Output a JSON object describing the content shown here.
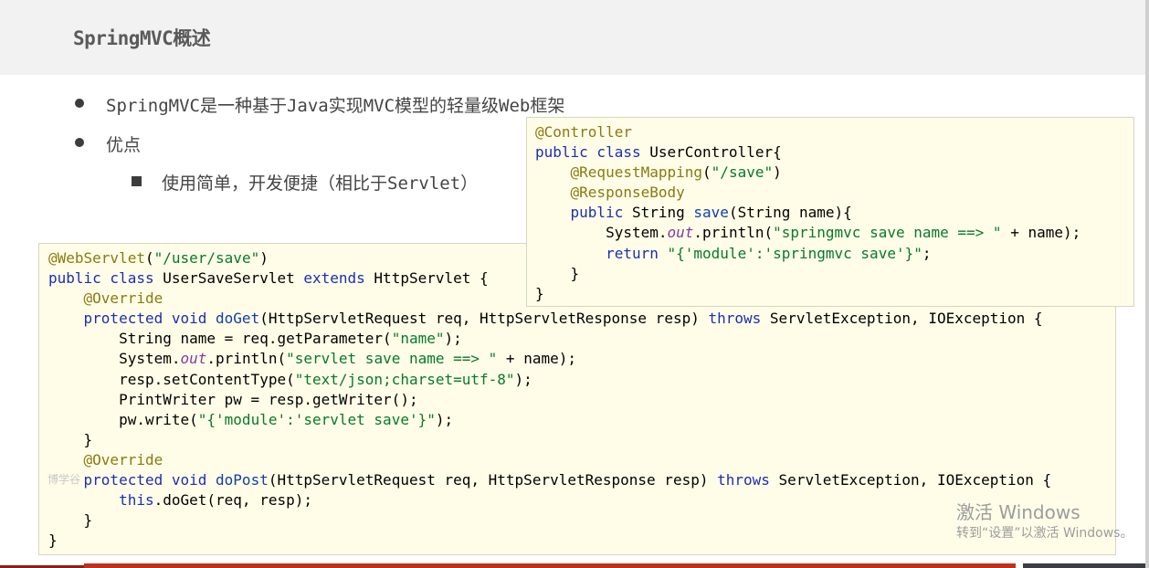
{
  "slide": {
    "title": "SpringMVC概述",
    "bullets": [
      {
        "text": "SpringMVC是一种基于Java实现MVC模型的轻量级Web框架"
      },
      {
        "text": "优点"
      }
    ],
    "sub_bullets": [
      {
        "text": "使用简单，开发便捷（相比于Servlet）"
      }
    ]
  },
  "code_servlet": {
    "lines": [
      [
        [
          "ann",
          "@WebServlet"
        ],
        [
          "p",
          "("
        ],
        [
          "str",
          "\"/user/save\""
        ],
        [
          "p",
          ")"
        ]
      ],
      [
        [
          "kw",
          "public class "
        ],
        [
          "p",
          "UserSaveServlet "
        ],
        [
          "kw",
          "extends "
        ],
        [
          "p",
          "HttpServlet {"
        ]
      ],
      [
        [
          "p",
          "    "
        ],
        [
          "ann",
          "@Override"
        ]
      ],
      [
        [
          "p",
          "    "
        ],
        [
          "kw",
          "protected void "
        ],
        [
          "mth",
          "doGet"
        ],
        [
          "p",
          "(HttpServletRequest req, HttpServletResponse resp) "
        ],
        [
          "kw",
          "throws "
        ],
        [
          "p",
          "ServletException, IOException {"
        ]
      ],
      [
        [
          "p",
          "        String name = req.getParameter("
        ],
        [
          "str",
          "\"name\""
        ],
        [
          "p",
          ");"
        ]
      ],
      [
        [
          "p",
          "        System."
        ],
        [
          "fld",
          "out"
        ],
        [
          "p",
          ".println("
        ],
        [
          "str",
          "\"servlet save name ==> \""
        ],
        [
          "p",
          " + name);"
        ]
      ],
      [
        [
          "p",
          "        resp.setContentType("
        ],
        [
          "str",
          "\"text/json;charset=utf-8\""
        ],
        [
          "p",
          ");"
        ]
      ],
      [
        [
          "p",
          "        PrintWriter pw = resp.getWriter();"
        ]
      ],
      [
        [
          "p",
          "        pw.write("
        ],
        [
          "str",
          "\"{'module':'servlet save'}\""
        ],
        [
          "p",
          ");"
        ]
      ],
      [
        [
          "p",
          "    }"
        ]
      ],
      [
        [
          "p",
          "    "
        ],
        [
          "ann",
          "@Override"
        ]
      ],
      [
        [
          "p",
          "    "
        ],
        [
          "kw",
          "protected void "
        ],
        [
          "mth",
          "doPost"
        ],
        [
          "p",
          "(HttpServletRequest req, HttpServletResponse resp) "
        ],
        [
          "kw",
          "throws "
        ],
        [
          "p",
          "ServletException, IOException {"
        ]
      ],
      [
        [
          "p",
          "        "
        ],
        [
          "kw",
          "this"
        ],
        [
          "p",
          ".doGet(req, resp);"
        ]
      ],
      [
        [
          "p",
          "    }"
        ]
      ],
      [
        [
          "p",
          "}"
        ]
      ]
    ]
  },
  "code_controller": {
    "lines": [
      [
        [
          "ann",
          "@Controller"
        ]
      ],
      [
        [
          "kw",
          "public class "
        ],
        [
          "p",
          "UserController{"
        ]
      ],
      [
        [
          "p",
          "    "
        ],
        [
          "ann",
          "@RequestMapping"
        ],
        [
          "p",
          "("
        ],
        [
          "str",
          "\"/save\""
        ],
        [
          "p",
          ")"
        ]
      ],
      [
        [
          "p",
          "    "
        ],
        [
          "ann",
          "@ResponseBody"
        ]
      ],
      [
        [
          "p",
          "    "
        ],
        [
          "kw",
          "public "
        ],
        [
          "p",
          "String "
        ],
        [
          "mth",
          "save"
        ],
        [
          "p",
          "(String name){"
        ]
      ],
      [
        [
          "p",
          "        System."
        ],
        [
          "fld",
          "out"
        ],
        [
          "p",
          ".println("
        ],
        [
          "str",
          "\"springmvc save name ==> \""
        ],
        [
          "p",
          " + name);"
        ]
      ],
      [
        [
          "p",
          "        "
        ],
        [
          "kw",
          "return "
        ],
        [
          "str",
          "\"{'module':'springmvc save'}\""
        ],
        [
          "p",
          ";"
        ]
      ],
      [
        [
          "p",
          "    }"
        ]
      ],
      [
        [
          "p",
          "}"
        ]
      ]
    ]
  },
  "watermark": {
    "small_text": "博学谷",
    "activation_line1": "激活 Windows",
    "activation_line2": "转到“设置”以激活 Windows。"
  }
}
